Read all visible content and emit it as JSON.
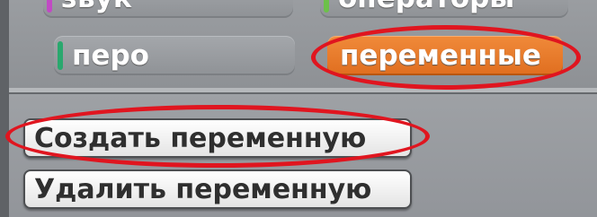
{
  "categories": {
    "zvuk": {
      "label": "звук",
      "strip_color": "#c14ac4"
    },
    "operatory": {
      "label": "операторы",
      "strip_color": "#6cc04a"
    },
    "pero": {
      "label": "перо",
      "strip_color": "#2aa86e"
    },
    "peremennye": {
      "label": "переменные",
      "selected": true,
      "color": "#ea7a2a"
    }
  },
  "variable_buttons": {
    "create_label": "Создать переменную",
    "delete_label": "Удалить переменную"
  },
  "annotation_color": "#e0151f"
}
